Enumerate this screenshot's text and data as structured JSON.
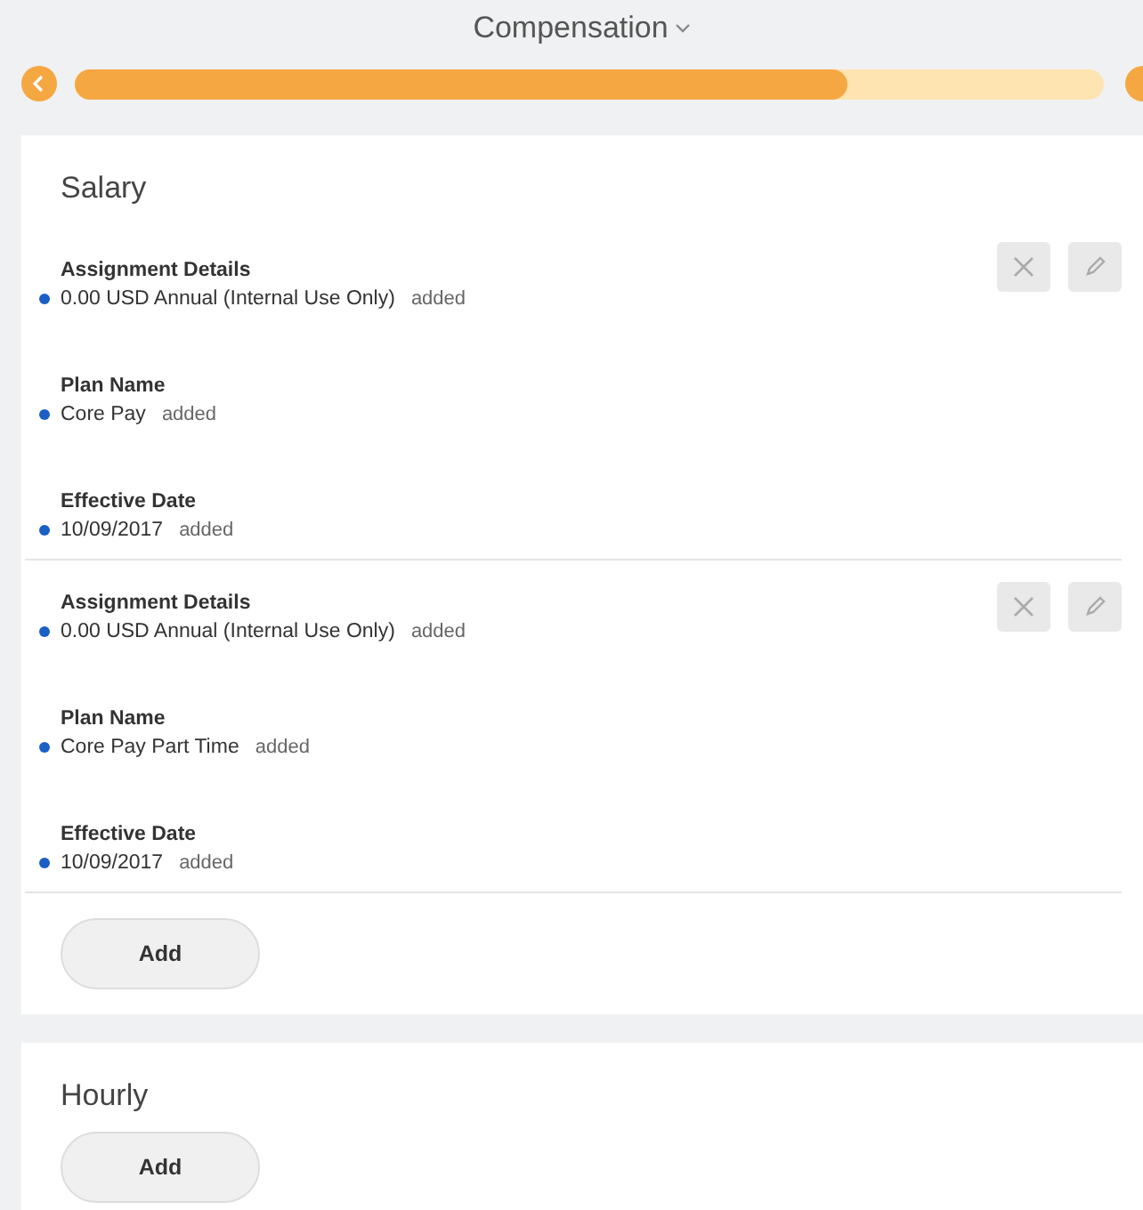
{
  "header": {
    "title": "Compensation",
    "progress": {
      "level": 0.75
    }
  },
  "sections": [
    {
      "title": "Salary",
      "entries": [
        {
          "fields": [
            {
              "label": "Assignment Details",
              "value": "0.00 USD Annual (Internal Use Only)",
              "status": "added"
            },
            {
              "label": "Plan Name",
              "value": "Core Pay",
              "status": "added"
            },
            {
              "label": "Effective Date",
              "value": "10/09/2017",
              "status": "added"
            }
          ]
        },
        {
          "fields": [
            {
              "label": "Assignment Details",
              "value": "0.00 USD Annual (Internal Use Only)",
              "status": "added"
            },
            {
              "label": "Plan Name",
              "value": "Core Pay Part Time",
              "status": "added"
            },
            {
              "label": "Effective Date",
              "value": "10/09/2017",
              "status": "added"
            }
          ]
        }
      ],
      "button": "Add"
    },
    {
      "title": "Hourly",
      "button": "Add"
    }
  ]
}
